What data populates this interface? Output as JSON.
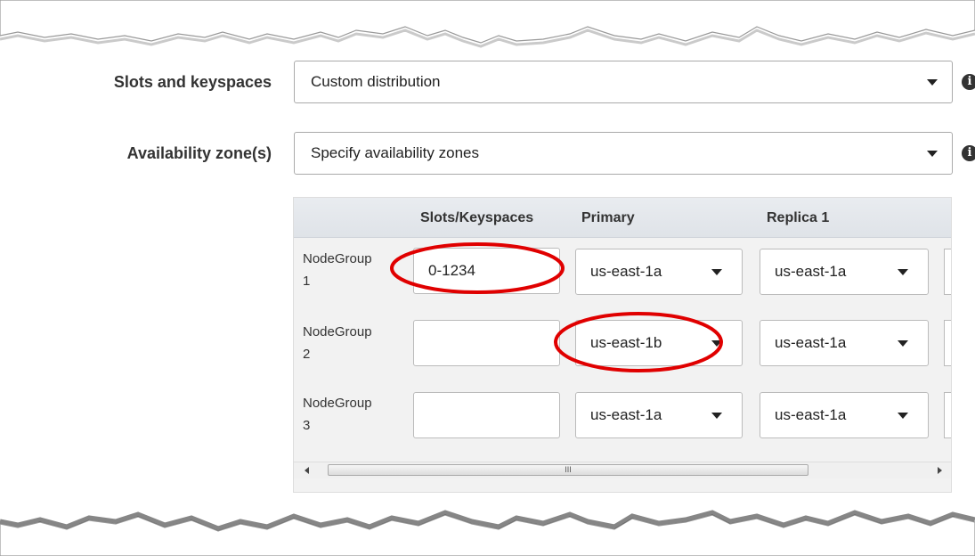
{
  "form": {
    "slots_label": "Slots and keyspaces",
    "slots_value": "Custom distribution",
    "az_label": "Availability zone(s)",
    "az_value": "Specify availability zones",
    "info_glyph": "i"
  },
  "table": {
    "headers": {
      "slots": "Slots/Keyspaces",
      "primary": "Primary",
      "replica1": "Replica 1"
    },
    "rows": [
      {
        "label_line1": "NodeGroup",
        "label_line2": "1",
        "slots": "0-1234",
        "primary": "us-east-1a",
        "replica1": "us-east-1a"
      },
      {
        "label_line1": "NodeGroup",
        "label_line2": "2",
        "slots": "",
        "primary": "us-east-1b",
        "replica1": "us-east-1a"
      },
      {
        "label_line1": "NodeGroup",
        "label_line2": "3",
        "slots": "",
        "primary": "us-east-1a",
        "replica1": "us-east-1a"
      }
    ],
    "scroll_grip": "III"
  },
  "colors": {
    "highlight": "#e00000",
    "header_bg": "#e3e7ec",
    "table_bg": "#f2f2f2"
  }
}
